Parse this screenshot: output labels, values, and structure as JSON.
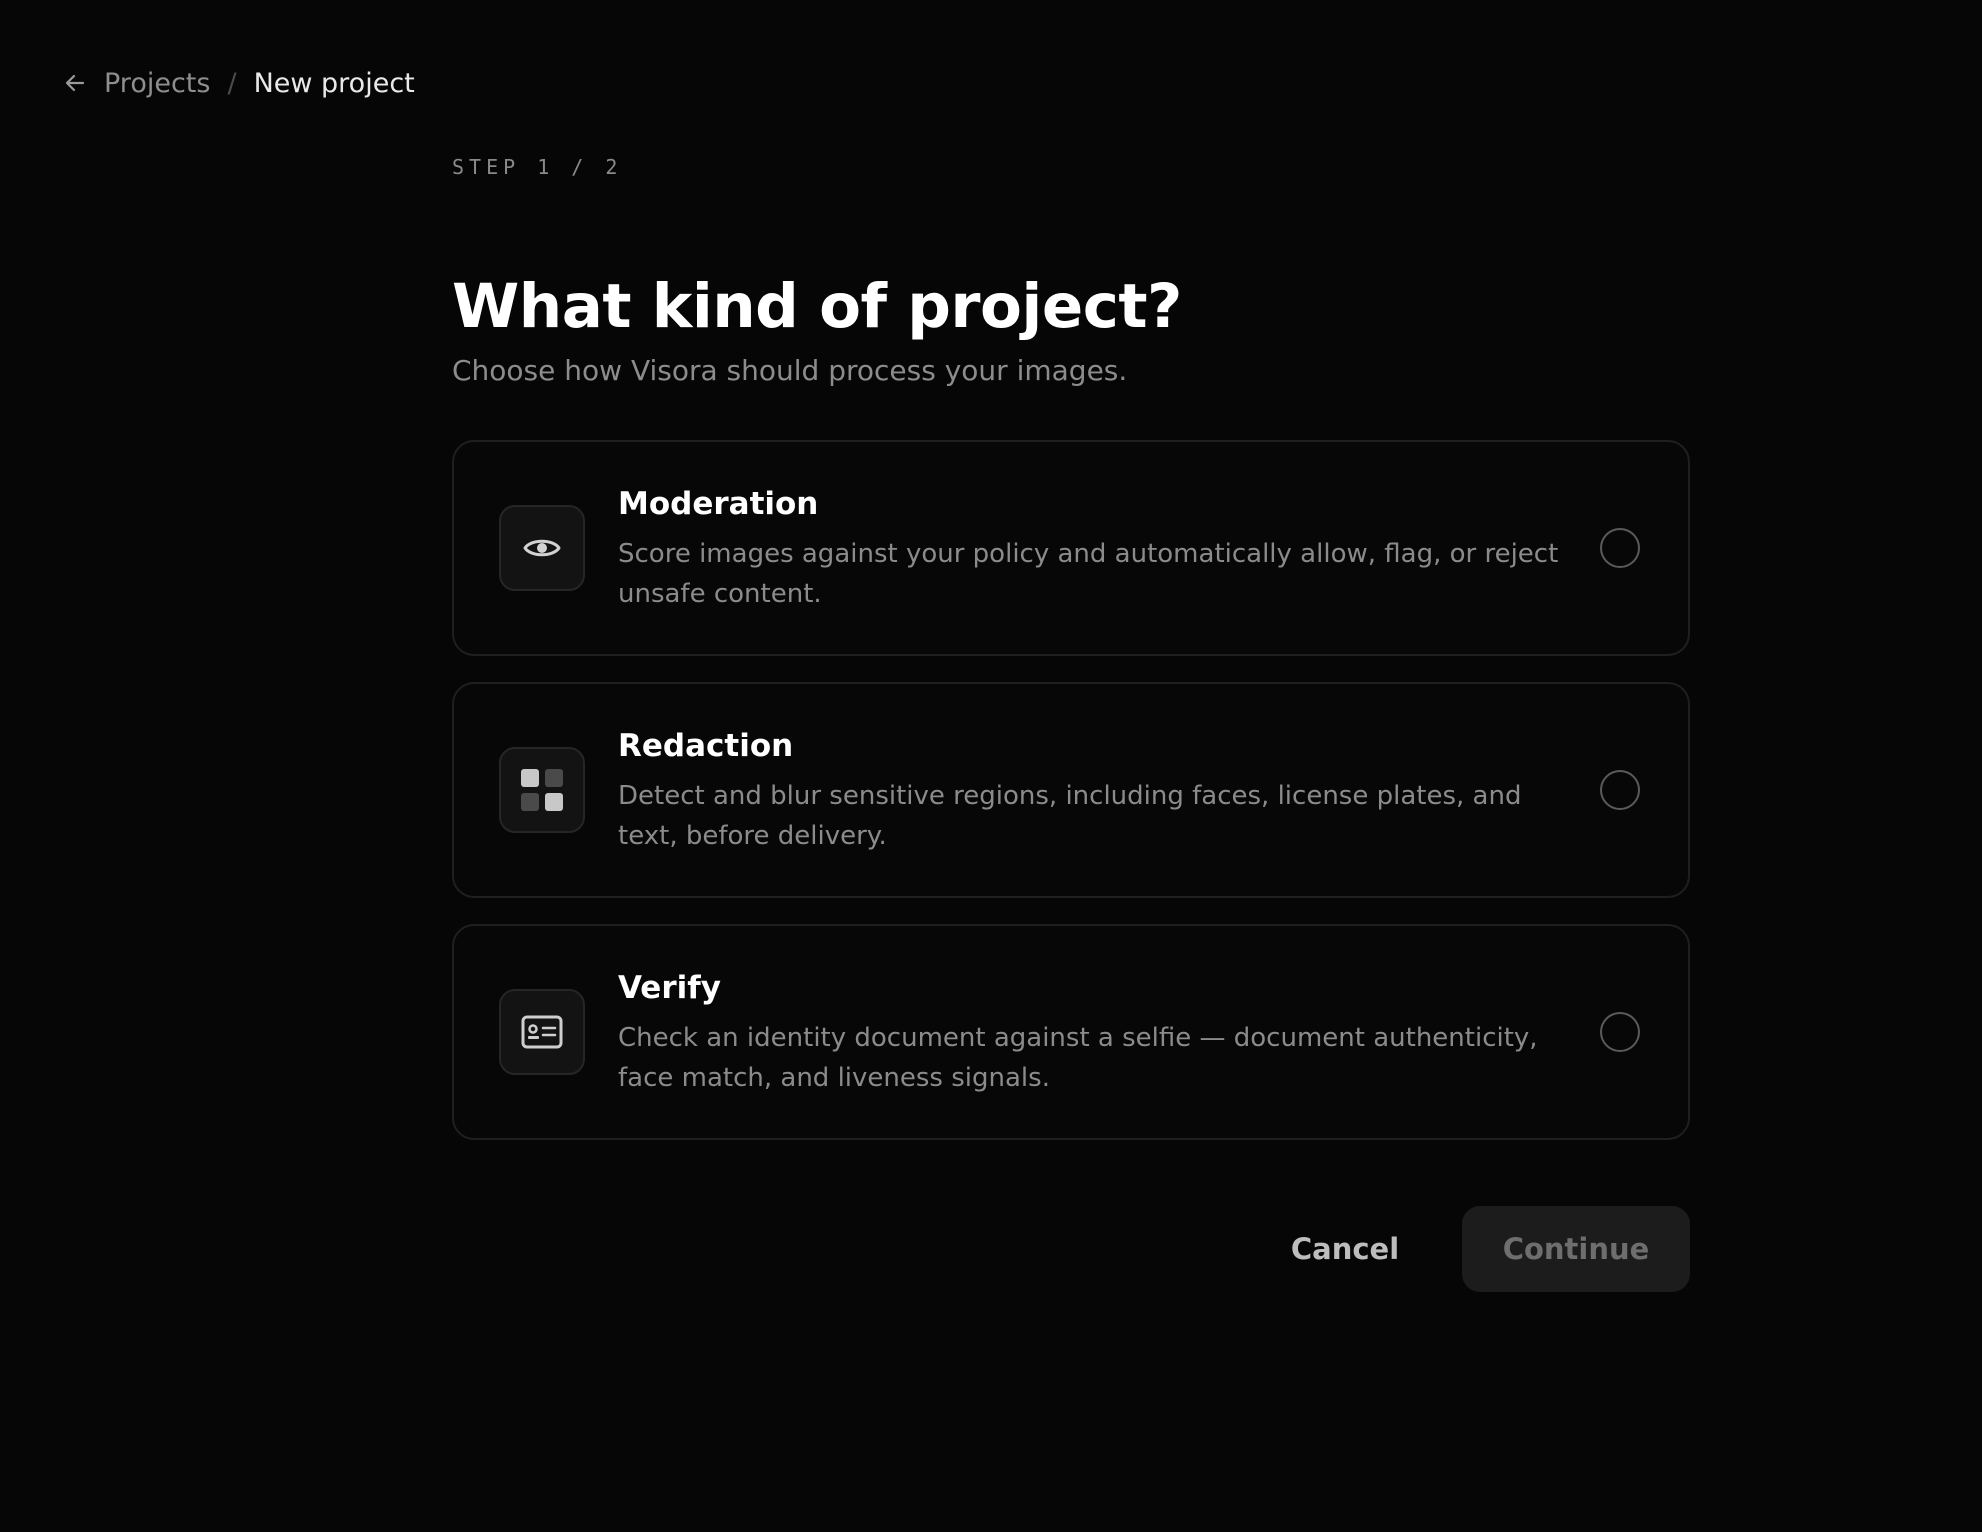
{
  "breadcrumb": {
    "back_icon": "arrow-left-icon",
    "parent": "Projects",
    "separator": "/",
    "current": "New project"
  },
  "step": "STEP 1 / 2",
  "title": "What kind of project?",
  "subtitle": "Choose how Visora should process your images.",
  "options": [
    {
      "id": "moderation",
      "icon": "eye-icon",
      "title": "Moderation",
      "description": "Score images against your policy and automatically allow, flag, or reject unsafe content.",
      "selected": false
    },
    {
      "id": "redaction",
      "icon": "grid-blocks-icon",
      "title": "Redaction",
      "description": "Detect and blur sensitive regions, including faces, license plates, and text, before delivery.",
      "selected": false
    },
    {
      "id": "verify",
      "icon": "id-card-icon",
      "title": "Verify",
      "description": "Check an identity document against a selfie — document authenticity, face match, and liveness signals.",
      "selected": false
    }
  ],
  "actions": {
    "cancel_label": "Cancel",
    "continue_label": "Continue"
  },
  "colors": {
    "background": "#060606",
    "card_border": "#1f1f1f",
    "muted_text": "#8b8b8b",
    "continue_bg": "#1c1c1c"
  }
}
